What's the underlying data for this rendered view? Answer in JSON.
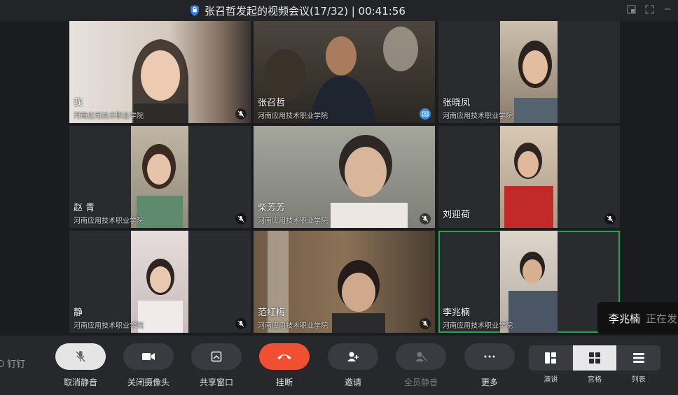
{
  "window": {
    "title": "张召哲发起的视频会议(17/32) | 00:41:56"
  },
  "participants": [
    {
      "name": "我",
      "org": "河南应用技术职业学院",
      "mic": "muted",
      "bg": "#d9d2c8",
      "video_bg": "#cfc6b8"
    },
    {
      "name": "张召哲",
      "org": "河南应用技术职业学院",
      "mic": "sharing",
      "bg": "#3b3a35",
      "video_bg": "#4a4236"
    },
    {
      "name": "张晓凤",
      "org": "河南应用技术职业学院",
      "mic": "none",
      "bg": "#2a2b2f",
      "video_bg": "#b9a894"
    },
    {
      "name": "赵 青",
      "org": "河南应用技术职业学院",
      "mic": "muted",
      "bg": "#2a2b2f",
      "video_bg": "#a9a18e"
    },
    {
      "name": "柴芳芳",
      "org": "河南应用技术职业学院",
      "mic": "muted",
      "bg": "#8e9087",
      "video_bg": "#8e9087"
    },
    {
      "name": "刘迎荷",
      "org": "",
      "mic": "muted",
      "bg": "#2a2b2f",
      "video_bg": "#c7b7a3"
    },
    {
      "name": "静",
      "org": "河南应用技术职业学院",
      "mic": "muted",
      "bg": "#2a2b2f",
      "video_bg": "#d8cfcf"
    },
    {
      "name": "范红梅",
      "org": "河南应用技术职业学院",
      "mic": "muted",
      "bg": "#5b4a38",
      "video_bg": "#5b4a38"
    },
    {
      "name": "李兆楠",
      "org": "河南应用技术职业学院",
      "mic": "none",
      "bg": "#2a2b2f",
      "video_bg": "#c9c2b8",
      "active": true
    }
  ],
  "speaking": {
    "who": "李兆楠",
    "status": "正在发"
  },
  "brand": "钉钉",
  "toolbar": {
    "unmute": "取消静音",
    "camera_off": "关闭摄像头",
    "share_window": "共享窗口",
    "hang_up": "挂断",
    "invite": "邀请",
    "mute_all": "全员静音",
    "more": "更多"
  },
  "layouts": {
    "presenter": "演讲",
    "grid": "宫格",
    "list": "列表",
    "selected": "grid"
  },
  "colors": {
    "accent_green": "#1fa64a",
    "hangup_red": "#f0502f",
    "share_blue": "#3a8ee6"
  }
}
